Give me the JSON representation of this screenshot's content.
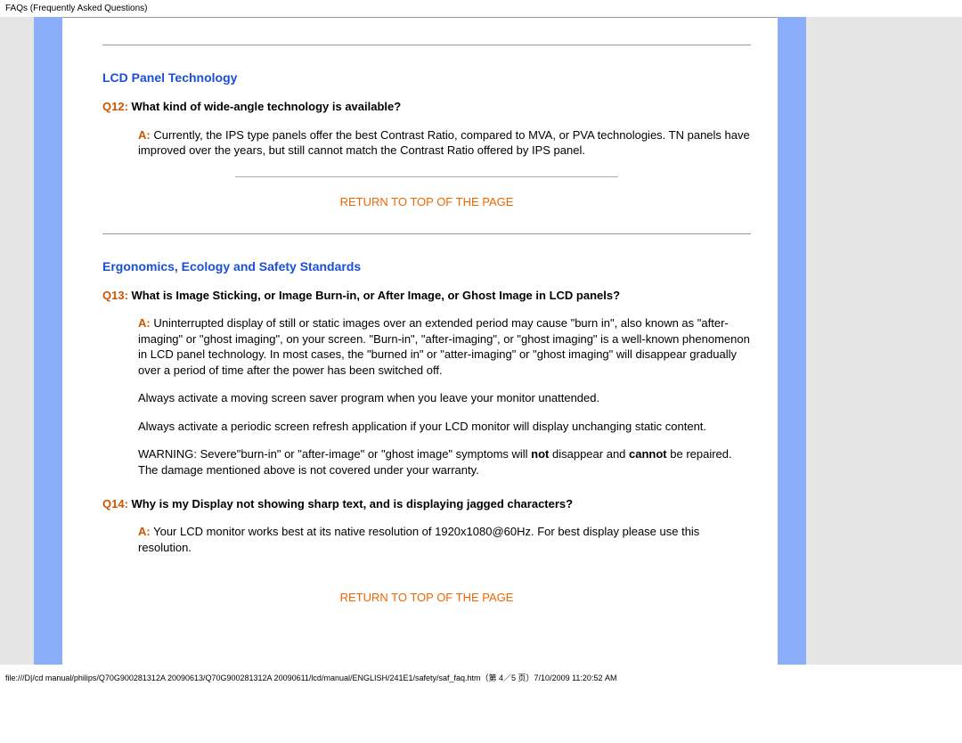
{
  "header": "FAQs (Frequently Asked Questions)",
  "section1": {
    "title": "LCD Panel Technology",
    "q12": {
      "num": "Q12:",
      "text": "What kind of wide-angle technology is available?",
      "a_label": "A:",
      "a_text": "Currently, the IPS type panels offer the best Contrast Ratio, compared to MVA, or PVA technologies.  TN panels have improved over the years, but still cannot match the Contrast Ratio offered by IPS panel."
    }
  },
  "return1": "RETURN TO TOP OF THE PAGE",
  "section2": {
    "title": "Ergonomics, Ecology and Safety Standards",
    "q13": {
      "num": "Q13:",
      "text": "What is Image Sticking, or Image Burn-in, or After Image, or Ghost Image in LCD panels?",
      "a_label": "A:",
      "p1": "Uninterrupted display of still or static images over an extended period may cause \"burn in\", also known as \"after-imaging\" or \"ghost imaging\", on your screen. \"Burn-in\", \"after-imaging\", or \"ghost imaging\" is a well-known phenomenon in LCD panel technology. In most cases, the \"burned in\" or \"atter-imaging\" or \"ghost imaging\" will disappear gradually over a period of time after the power has been switched off.",
      "p2": "Always activate a moving screen saver program when you leave your monitor unattended.",
      "p3": "Always activate a periodic screen refresh application if your LCD monitor will display unchanging static content.",
      "p4a": "WARNING: Severe\"burn-in\" or \"after-image\" or \"ghost image\" symptoms will ",
      "p4not": "not",
      "p4b": " disappear and ",
      "p4cannot": "cannot",
      "p4c": " be repaired. The damage mentioned above is not covered under your warranty."
    },
    "q14": {
      "num": "Q14:",
      "text": "Why is my Display not showing sharp text, and is displaying jagged characters?",
      "a_label": "A:",
      "a_text": "Your LCD monitor works best at its native resolution of 1920x1080@60Hz. For best display please use this resolution."
    }
  },
  "return2": "RETURN TO TOP OF THE PAGE",
  "footer": "file:///D|/cd manual/philips/Q70G900281312A 20090613/Q70G900281312A 20090611/lcd/manual/ENGLISH/241E1/safety/saf_faq.htm（第 4／5 页）7/10/2009 11:20:52 AM"
}
